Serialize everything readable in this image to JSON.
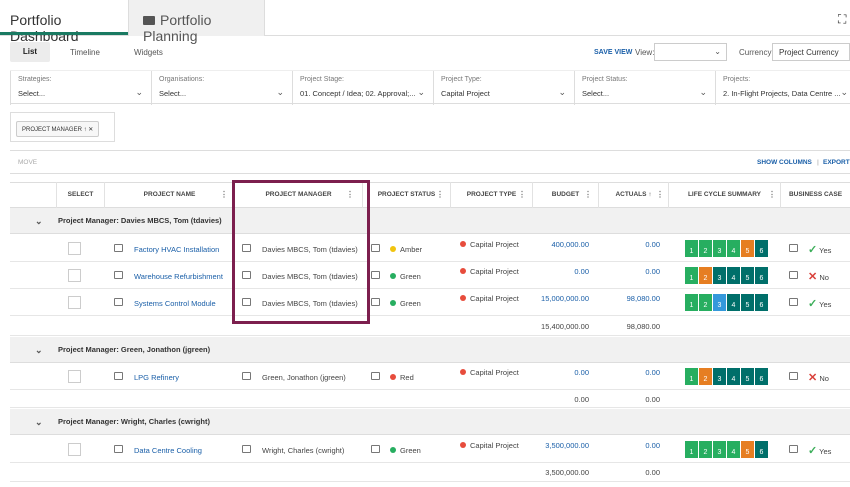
{
  "tabs": {
    "active": "Portfolio Dashboard",
    "inactive": "Portfolio Planning"
  },
  "view_tabs": {
    "list": "List",
    "timeline": "Timeline",
    "widgets": "Widgets"
  },
  "toolbar": {
    "save_view": "SAVE VIEW",
    "view_label": "View:",
    "view_value": "",
    "currency_label": "Currency:",
    "currency_value": "Project Currency"
  },
  "filters": [
    {
      "label": "Strategies:",
      "value": "Select..."
    },
    {
      "label": "Organisations:",
      "value": "Select..."
    },
    {
      "label": "Project Stage:",
      "value": "01. Concept / Idea; 02. Approval;..."
    },
    {
      "label": "Project Type:",
      "value": "Capital Project"
    },
    {
      "label": "Project Status:",
      "value": "Select..."
    },
    {
      "label": "Projects:",
      "value": "2. In-Flight Projects, Data Centre ..."
    }
  ],
  "grouping_chip": "PROJECT MANAGER",
  "actions": {
    "move": "MOVE",
    "show_columns": "SHOW COLUMNS",
    "export": "EXPORT"
  },
  "columns": {
    "select": "SELECT",
    "project_name": "PROJECT NAME",
    "project_manager": "PROJECT MANAGER",
    "project_status": "PROJECT STATUS",
    "project_type": "PROJECT TYPE",
    "budget": "BUDGET",
    "actuals": "ACTUALS",
    "life_cycle": "LIFE CYCLE SUMMARY",
    "business_case": "BUSINESS CASE"
  },
  "colors": {
    "green": "#27ae60",
    "teal": "#006f6a",
    "orange": "#e67e22",
    "blue": "#3498db",
    "amber": "#f1c40f",
    "red": "#e74c3c"
  },
  "groups": [
    {
      "title": "Project Manager: Davies MBCS, Tom (tdavies)",
      "total_budget": "15,400,000.00",
      "total_actuals": "98,080.00"
    },
    {
      "title": "Project Manager: Green, Jonathon (jgreen)",
      "total_budget": "0.00",
      "total_actuals": "0.00"
    },
    {
      "title": "Project Manager: Wright, Charles (cwright)",
      "total_budget": "3,500,000.00",
      "total_actuals": "0.00"
    }
  ],
  "rows": [
    {
      "name": "Factory HVAC Installation",
      "manager": "Davies MBCS, Tom (tdavies)",
      "status": "Amber",
      "type": "Capital Project",
      "budget": "400,000.00",
      "actuals": "0.00",
      "bc": "Yes",
      "lc": [
        "1",
        "2",
        "3",
        "4",
        "5",
        "6"
      ]
    },
    {
      "name": "Warehouse Refurbishment",
      "manager": "Davies MBCS, Tom (tdavies)",
      "status": "Green",
      "type": "Capital Project",
      "budget": "0.00",
      "actuals": "0.00",
      "bc": "No",
      "lc": [
        "1",
        "2",
        "3",
        "4",
        "5",
        "6"
      ]
    },
    {
      "name": "Systems Control Module",
      "manager": "Davies MBCS, Tom (tdavies)",
      "status": "Green",
      "type": "Capital Project",
      "budget": "15,000,000.00",
      "actuals": "98,080.00",
      "bc": "Yes",
      "lc": [
        "1",
        "2",
        "3",
        "4",
        "5",
        "6"
      ]
    },
    {
      "name": "LPG Refinery",
      "manager": "Green, Jonathon (jgreen)",
      "status": "Red",
      "type": "Capital Project",
      "budget": "0.00",
      "actuals": "0.00",
      "bc": "No",
      "lc": [
        "1",
        "2",
        "3",
        "4",
        "5",
        "6"
      ]
    },
    {
      "name": "Data Centre Cooling",
      "manager": "Wright, Charles (cwright)",
      "status": "Green",
      "type": "Capital Project",
      "budget": "3,500,000.00",
      "actuals": "0.00",
      "bc": "Yes",
      "lc": [
        "1",
        "2",
        "3",
        "4",
        "5",
        "6"
      ]
    }
  ]
}
